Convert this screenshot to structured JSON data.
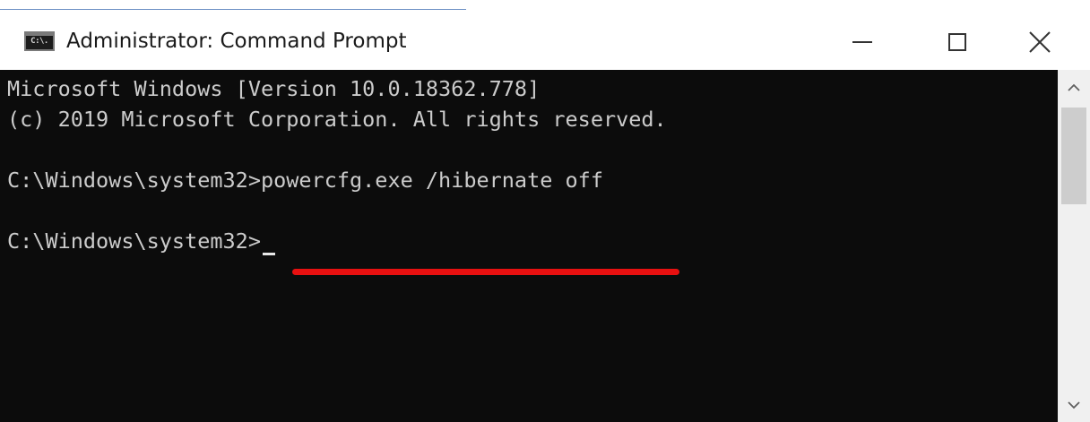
{
  "window": {
    "title": "Administrator: Command Prompt",
    "icon_label": "C:\\."
  },
  "titlebar_buttons": {
    "minimize": "minimize-icon",
    "maximize": "maximize-icon",
    "close": "close-icon"
  },
  "console": {
    "lines": [
      {
        "text": "Microsoft Windows [Version 10.0.18362.778]"
      },
      {
        "text": "(c) 2019 Microsoft Corporation. All rights reserved."
      },
      {
        "prompt": "C:\\Windows\\system32>",
        "command": "powercfg.exe /hibernate off"
      },
      {
        "prompt": "C:\\Windows\\system32>",
        "command": ""
      }
    ]
  },
  "colors": {
    "console_background": "#0c0c0c",
    "console_text": "#cccccc",
    "highlight_underline": "#e81010",
    "titlebar_background": "#ffffff"
  },
  "scrollbar": {
    "up_icon": "chevron-up-icon",
    "down_icon": "chevron-down-icon"
  }
}
